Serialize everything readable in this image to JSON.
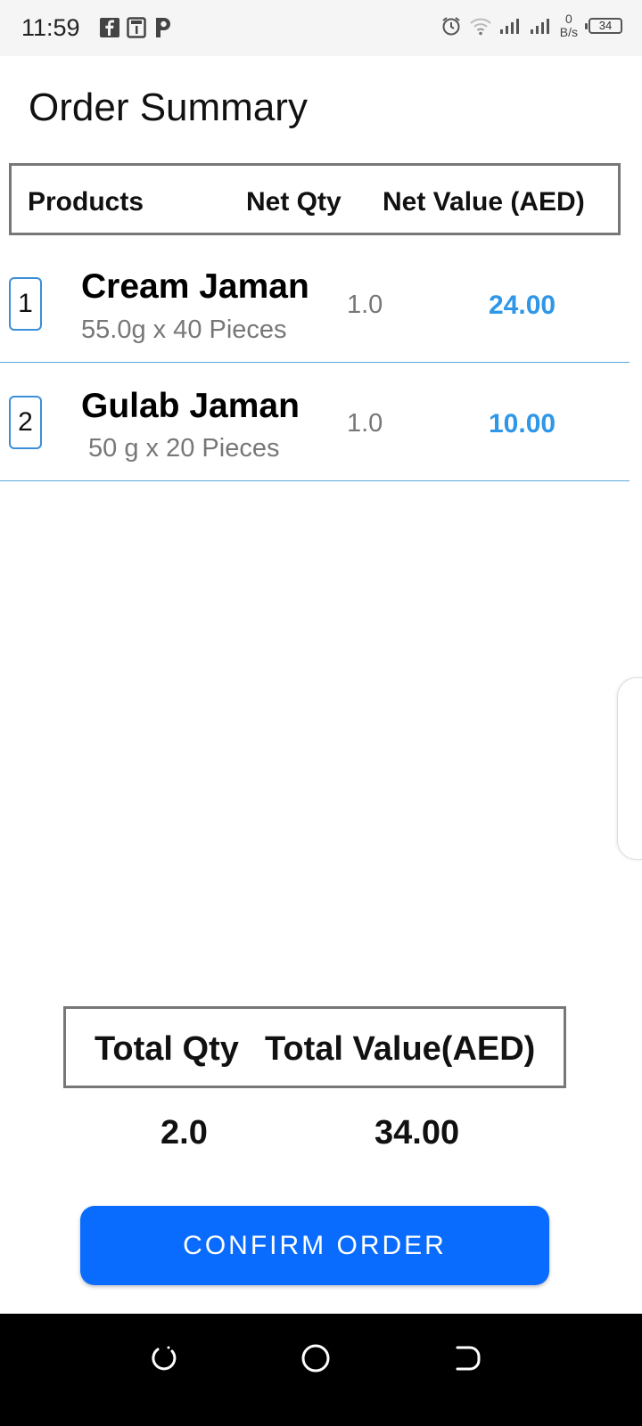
{
  "status_bar": {
    "time": "11:59",
    "network_speed_value": "0",
    "network_speed_unit": "B/s",
    "battery": "34",
    "icons": [
      "facebook-icon",
      "sim-icon",
      "paytm-icon",
      "alarm-icon",
      "wifi-icon",
      "signal-icon",
      "signal-icon-2"
    ]
  },
  "page": {
    "title": "Order Summary"
  },
  "table": {
    "headers": {
      "products": "Products",
      "qty": "Net Qty",
      "value": "Net Value (AED)"
    },
    "rows": [
      {
        "index": "1",
        "name": "Cream Jaman",
        "description": "55.0g x 40 Pieces",
        "qty": "1.0",
        "value": "24.00"
      },
      {
        "index": "2",
        "name": "Gulab Jaman",
        "description": " 50 g x 20 Pieces",
        "qty": "1.0",
        "value": "10.00"
      }
    ]
  },
  "totals": {
    "qty_label": "Total Qty",
    "value_label": "Total Value(AED)",
    "qty": "2.0",
    "value": "34.00"
  },
  "actions": {
    "confirm_label": "CONFIRM ORDER"
  },
  "colors": {
    "accent": "#0a6cff",
    "value_text": "#2f97e8",
    "row_divider": "#5aa9dd"
  }
}
